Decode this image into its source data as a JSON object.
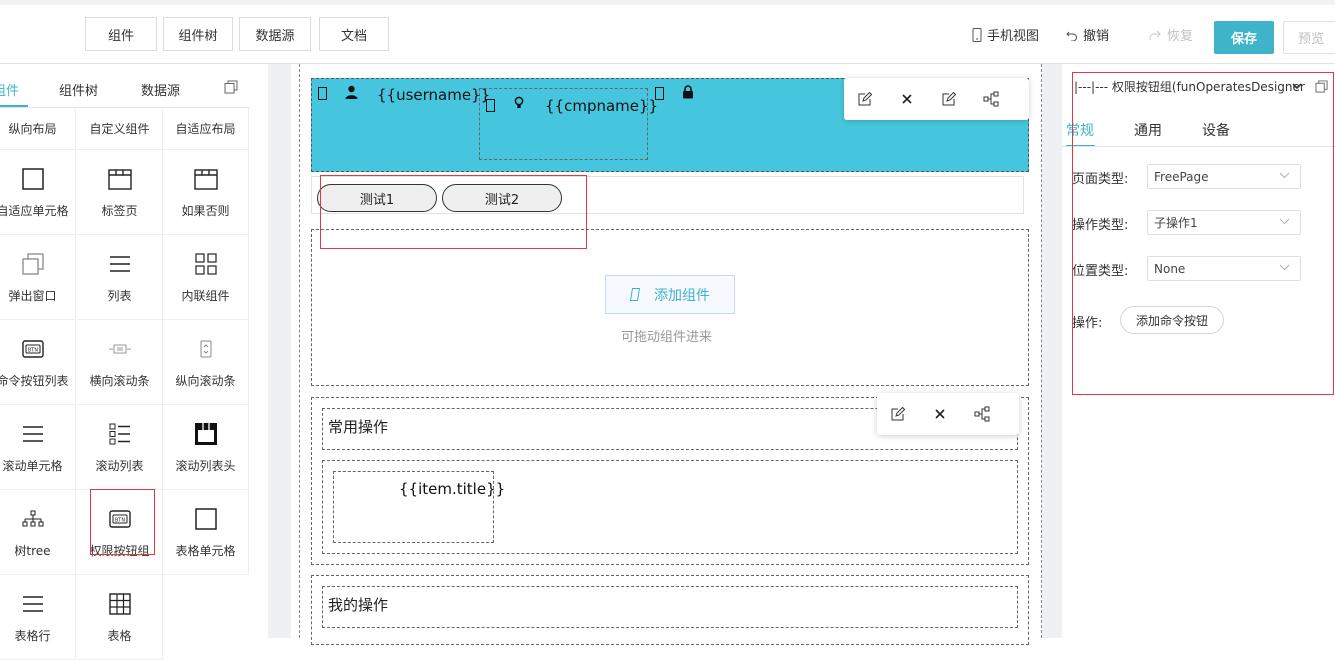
{
  "toolbar": {
    "buttons": [
      "组件",
      "组件树",
      "数据源",
      "文档"
    ],
    "mobile_view": "手机视图",
    "undo": "撤销",
    "redo": "恢复",
    "save": "保存",
    "preview": "预览"
  },
  "left_panel": {
    "tabs": [
      "组件",
      "组件树",
      "数据源"
    ],
    "active_tab": "组件",
    "components": [
      {
        "label": "纵向布局",
        "icon": "none"
      },
      {
        "label": "自定义组件",
        "icon": "none"
      },
      {
        "label": "自适应布局",
        "icon": "none"
      },
      {
        "label": "自适应单元格",
        "icon": "square-icon"
      },
      {
        "label": "标签页",
        "icon": "folder-tab-icon"
      },
      {
        "label": "如果否则",
        "icon": "folder-tab-icon"
      },
      {
        "label": "弹出窗口",
        "icon": "popup-icon"
      },
      {
        "label": "列表",
        "icon": "list-icon"
      },
      {
        "label": "内联组件",
        "icon": "grid-icon"
      },
      {
        "label": "命令按钮列表",
        "icon": "btn-icon"
      },
      {
        "label": "横向滚动条",
        "icon": "hscroll-icon"
      },
      {
        "label": "纵向滚动条",
        "icon": "vscroll-icon"
      },
      {
        "label": "滚动单元格",
        "icon": "list-icon"
      },
      {
        "label": "滚动列表",
        "icon": "list-detail-icon"
      },
      {
        "label": "滚动列表头",
        "icon": "table-header-icon"
      },
      {
        "label": "树tree",
        "icon": "tree-icon"
      },
      {
        "label": "权限按钮组",
        "icon": "btn-icon"
      },
      {
        "label": "表格单元格",
        "icon": "square-icon"
      },
      {
        "label": "表格行",
        "icon": "list-icon"
      },
      {
        "label": "表格",
        "icon": "table-icon"
      }
    ]
  },
  "canvas": {
    "header": {
      "username": "{{username}}",
      "cmpname": "{{cmpname}}"
    },
    "permission_buttons": [
      "测试1",
      "测试2"
    ],
    "add_component": {
      "button": "添加组件",
      "hint": "可拖动组件进来"
    },
    "common_ops_title": "常用操作",
    "item_title": "{{item.title}}",
    "my_ops_title": "我的操作"
  },
  "right_panel": {
    "selector": "|---|--- 权限按钮组(funOperatesDesigner",
    "tabs": [
      "常规",
      "通用",
      "设备"
    ],
    "active_tab": "常规",
    "fields": [
      {
        "label": "页面类型:",
        "value": "FreePage"
      },
      {
        "label": "操作类型:",
        "value": "子操作1"
      },
      {
        "label": "位置类型:",
        "value": "None"
      }
    ],
    "ops_label": "操作:",
    "add_command_button": "添加命令按钮"
  },
  "colors": {
    "accent": "#3fb3c9",
    "header_bg": "#46c6de",
    "highlight_border": "#e0393e"
  }
}
